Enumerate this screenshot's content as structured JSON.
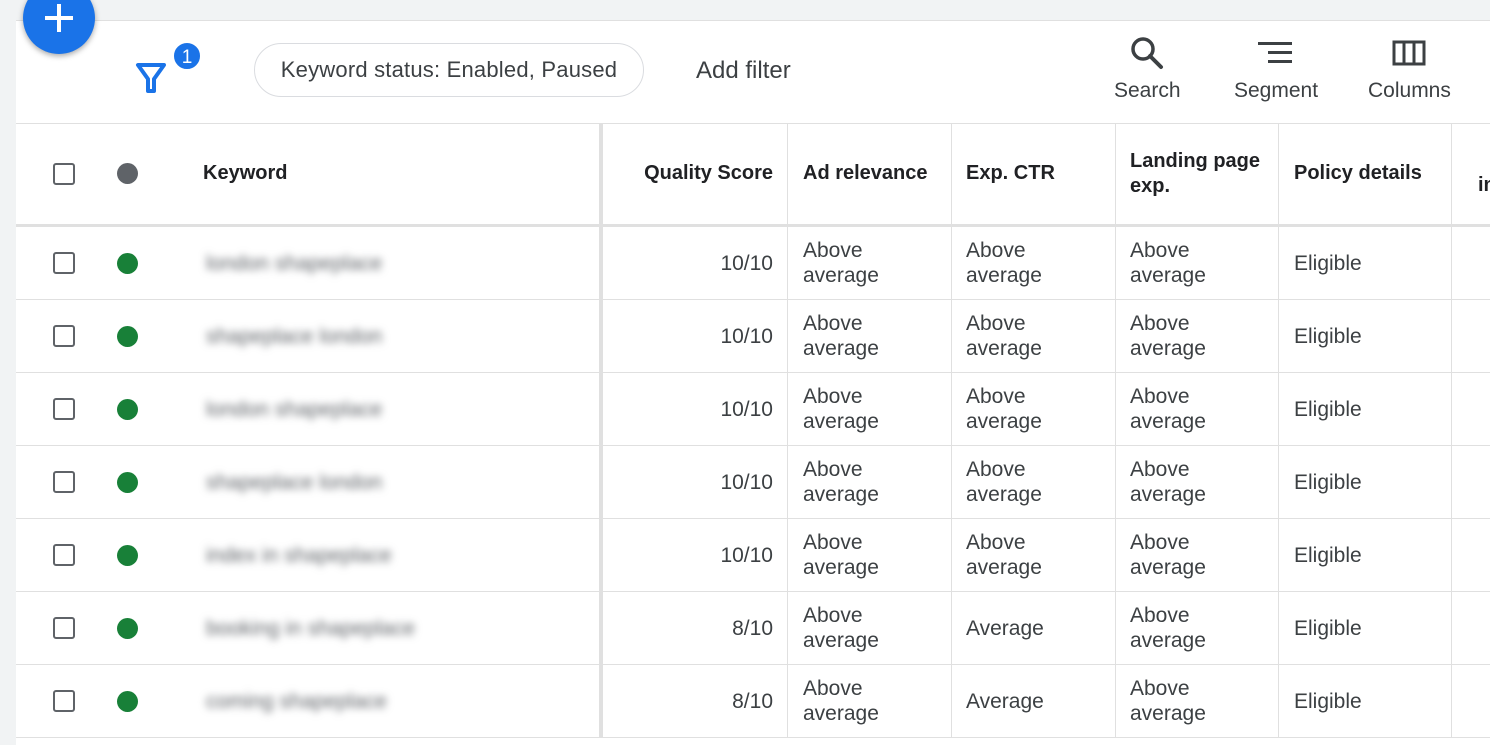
{
  "toolbar": {
    "filter_count": "1",
    "filter_chip": "Keyword status: Enabled, Paused",
    "add_filter": "Add filter",
    "tools": [
      {
        "label": "Search",
        "icon": "search-icon"
      },
      {
        "label": "Segment",
        "icon": "segment-icon"
      },
      {
        "label": "Columns",
        "icon": "columns-icon"
      }
    ]
  },
  "colors": {
    "accent": "#1a73e8",
    "status_enabled": "#188038",
    "status_header": "#5f6368"
  },
  "table": {
    "headers": {
      "keyword": "Keyword",
      "quality_score": "Quality Score",
      "ad_relevance": "Ad relevance",
      "exp_ctr": "Exp. CTR",
      "landing_page": "Landing page exp.",
      "policy": "Policy details",
      "partial": "im"
    },
    "rows": [
      {
        "keyword": "london shapeplace",
        "quality_score": "10/10",
        "ad_relevance": "Above average",
        "exp_ctr": "Above average",
        "landing_page": "Above average",
        "policy": "Eligible"
      },
      {
        "keyword": "shapeplace london",
        "quality_score": "10/10",
        "ad_relevance": "Above average",
        "exp_ctr": "Above average",
        "landing_page": "Above average",
        "policy": "Eligible"
      },
      {
        "keyword": "london shapeplace",
        "quality_score": "10/10",
        "ad_relevance": "Above average",
        "exp_ctr": "Above average",
        "landing_page": "Above average",
        "policy": "Eligible"
      },
      {
        "keyword": "shapeplace london",
        "quality_score": "10/10",
        "ad_relevance": "Above average",
        "exp_ctr": "Above average",
        "landing_page": "Above average",
        "policy": "Eligible"
      },
      {
        "keyword": "index in shapeplace",
        "quality_score": "10/10",
        "ad_relevance": "Above average",
        "exp_ctr": "Above average",
        "landing_page": "Above average",
        "policy": "Eligible"
      },
      {
        "keyword": "booking in shapeplace",
        "quality_score": "8/10",
        "ad_relevance": "Above average",
        "exp_ctr": "Average",
        "landing_page": "Above average",
        "policy": "Eligible"
      },
      {
        "keyword": "coming shapeplace",
        "quality_score": "8/10",
        "ad_relevance": "Above average",
        "exp_ctr": "Average",
        "landing_page": "Above average",
        "policy": "Eligible"
      }
    ]
  }
}
